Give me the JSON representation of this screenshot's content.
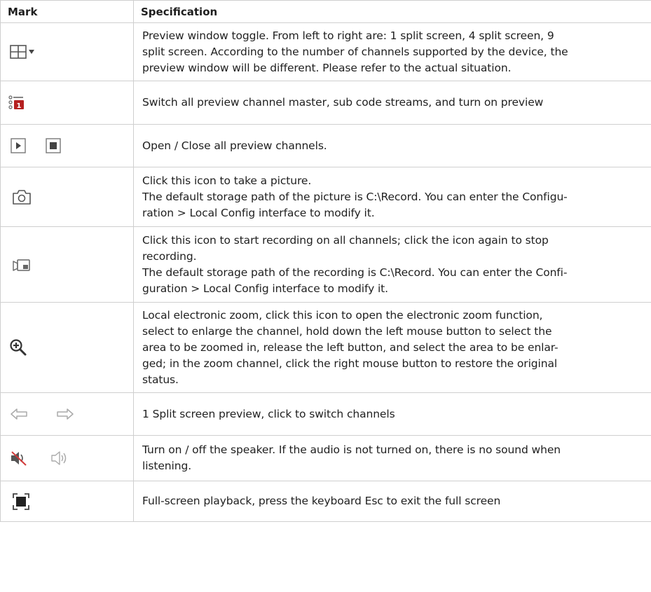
{
  "table": {
    "headers": {
      "mark": "Mark",
      "spec": "Specification"
    },
    "rows": [
      {
        "icons": [
          "split-screen-icon"
        ],
        "lines": [
          "Preview window toggle. From left to right are: 1 split screen, 4 split screen, 9",
          "split screen. According to the number of channels supported by the device, the",
          "preview window will be different. Please refer to the actual situation."
        ]
      },
      {
        "icons": [
          "stream-switch-icon"
        ],
        "lines": [
          "Switch all preview channel master, sub code streams, and turn on preview"
        ]
      },
      {
        "icons": [
          "play-icon",
          "stop-icon"
        ],
        "lines": [
          "Open / Close all preview channels."
        ]
      },
      {
        "icons": [
          "camera-icon"
        ],
        "lines": [
          "Click this icon to take a picture.",
          "The default storage path of the picture is C:\\Record. You can enter the Configu-",
          "ration > Local Config interface to modify it."
        ]
      },
      {
        "icons": [
          "record-icon"
        ],
        "lines": [
          "Click this icon to start recording on all channels; click the icon again to stop",
          "recording.",
          "The default storage path of the recording is C:\\Record. You can enter the Confi-",
          "guration > Local Config interface to modify it."
        ]
      },
      {
        "icons": [
          "zoom-in-icon"
        ],
        "lines": [
          "Local electronic zoom, click this icon to open the electronic zoom function,",
          "select to enlarge the channel, hold down the left mouse button to select the",
          "area to be zoomed in, release the left button, and select the area to be enlar-",
          "ged; in the zoom channel, click the right mouse button to restore the original",
          "status."
        ]
      },
      {
        "icons": [
          "arrow-left-icon",
          "arrow-right-icon"
        ],
        "lines": [
          "1 Split screen preview, click to switch channels"
        ]
      },
      {
        "icons": [
          "speaker-off-icon",
          "speaker-on-icon"
        ],
        "lines": [
          "Turn on / off the speaker. If the audio is not turned on, there is no sound when",
          "listening."
        ]
      },
      {
        "icons": [
          "fullscreen-icon"
        ],
        "lines": [
          "Full-screen playback, press the keyboard Esc to exit the full screen"
        ]
      }
    ]
  }
}
